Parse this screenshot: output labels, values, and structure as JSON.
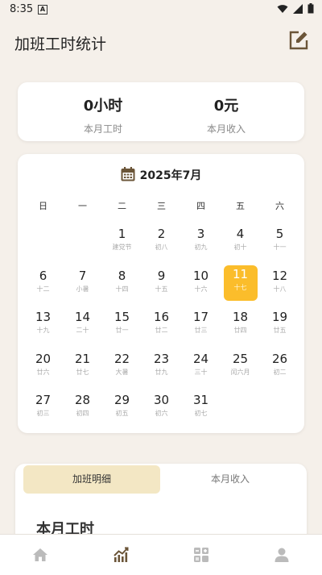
{
  "status": {
    "time": "8:35",
    "a_glyph": "A"
  },
  "header": {
    "title": "加班工时统计"
  },
  "stats": {
    "hours_value": "0小时",
    "hours_label": "本月工时",
    "income_value": "0元",
    "income_label": "本月收入"
  },
  "calendar": {
    "title": "2025年7月",
    "weekdays": [
      "日",
      "一",
      "二",
      "三",
      "四",
      "五",
      "六"
    ],
    "weeks": [
      [
        {
          "d": "",
          "l": ""
        },
        {
          "d": "",
          "l": ""
        },
        {
          "d": "1",
          "l": "建党节"
        },
        {
          "d": "2",
          "l": "初八"
        },
        {
          "d": "3",
          "l": "初九"
        },
        {
          "d": "4",
          "l": "初十"
        },
        {
          "d": "5",
          "l": "十一"
        }
      ],
      [
        {
          "d": "6",
          "l": "十二"
        },
        {
          "d": "7",
          "l": "小暑"
        },
        {
          "d": "8",
          "l": "十四"
        },
        {
          "d": "9",
          "l": "十五"
        },
        {
          "d": "10",
          "l": "十六"
        },
        {
          "d": "11",
          "l": "十七",
          "sel": true
        },
        {
          "d": "12",
          "l": "十八"
        }
      ],
      [
        {
          "d": "13",
          "l": "十九"
        },
        {
          "d": "14",
          "l": "二十"
        },
        {
          "d": "15",
          "l": "廿一"
        },
        {
          "d": "16",
          "l": "廿二"
        },
        {
          "d": "17",
          "l": "廿三"
        },
        {
          "d": "18",
          "l": "廿四"
        },
        {
          "d": "19",
          "l": "廿五"
        }
      ],
      [
        {
          "d": "20",
          "l": "廿六"
        },
        {
          "d": "21",
          "l": "廿七"
        },
        {
          "d": "22",
          "l": "大暑"
        },
        {
          "d": "23",
          "l": "廿九"
        },
        {
          "d": "24",
          "l": "三十"
        },
        {
          "d": "25",
          "l": "闰六月"
        },
        {
          "d": "26",
          "l": "初二"
        }
      ],
      [
        {
          "d": "27",
          "l": "初三"
        },
        {
          "d": "28",
          "l": "初四"
        },
        {
          "d": "29",
          "l": "初五"
        },
        {
          "d": "30",
          "l": "初六"
        },
        {
          "d": "31",
          "l": "初七"
        },
        {
          "d": "",
          "l": ""
        },
        {
          "d": "",
          "l": ""
        }
      ]
    ]
  },
  "tabs": {
    "active": "加班明细",
    "inactive": "本月收入"
  },
  "section": {
    "title": "本月工时"
  },
  "nav": {
    "items": [
      "home-icon",
      "chart-icon",
      "grid-icon",
      "person-icon"
    ]
  },
  "colors": {
    "accent": "#fbbd2b",
    "brown": "#6b5538",
    "background": "#f5f0ea"
  }
}
